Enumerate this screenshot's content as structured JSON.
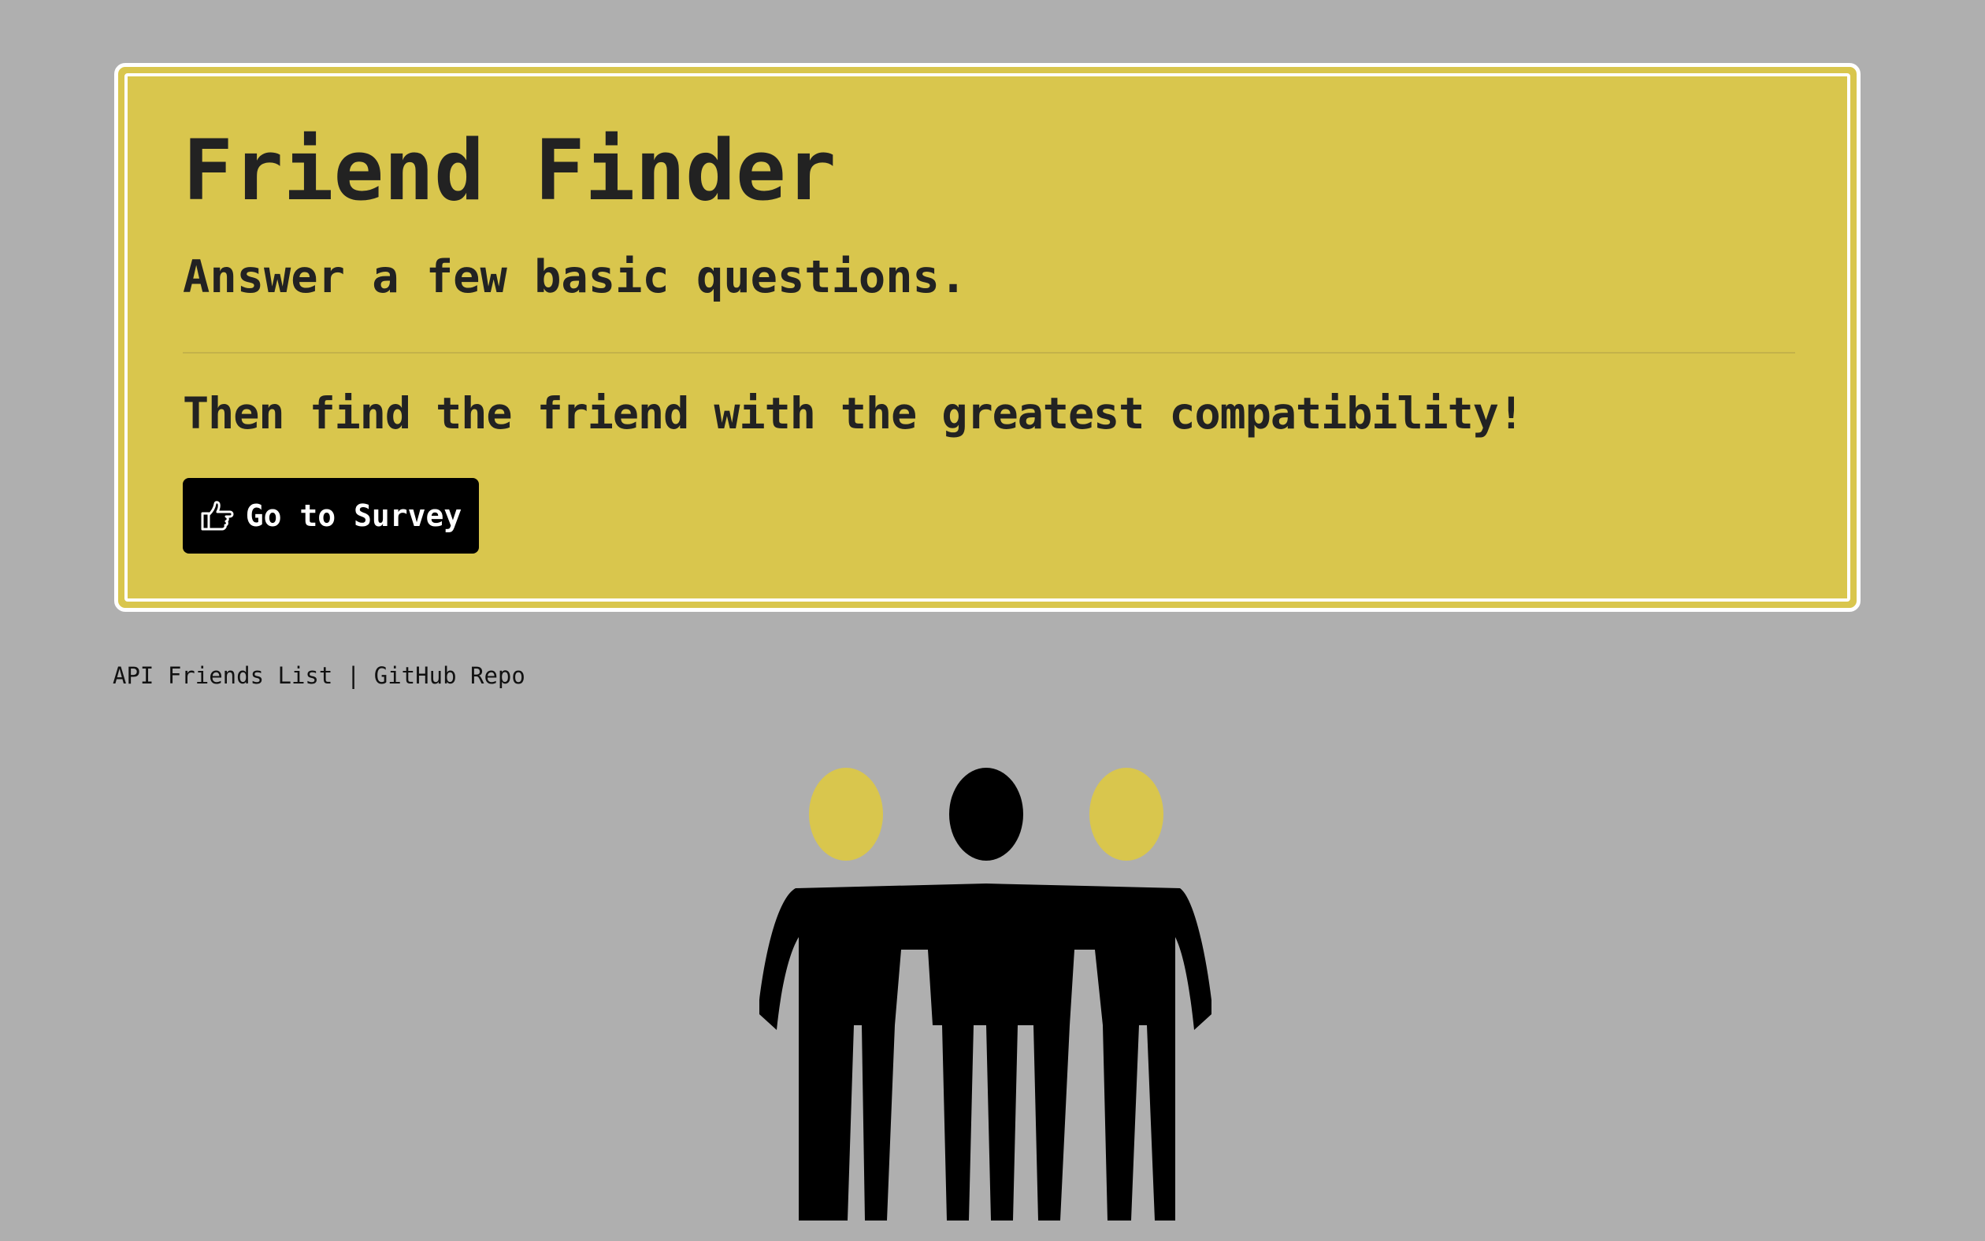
{
  "header": {
    "title": "Friend Finder",
    "lead": "Answer a few basic questions.",
    "subtitle": "Then find the friend with the greatest compatibility!",
    "survey_button_label": "Go to Survey",
    "survey_button_icon": "hand-point-right-icon"
  },
  "footer": {
    "api_link_label": "API Friends List",
    "separator": "|",
    "github_link_label": "GitHub Repo"
  },
  "colors": {
    "background": "#afafaf",
    "jumbotron": "#d9c64d",
    "border": "#ffffff",
    "button": "#000000",
    "figure_dark": "#000000",
    "figure_accent": "#d9c64d"
  },
  "illustration": {
    "icon": "three-friends-icon"
  }
}
